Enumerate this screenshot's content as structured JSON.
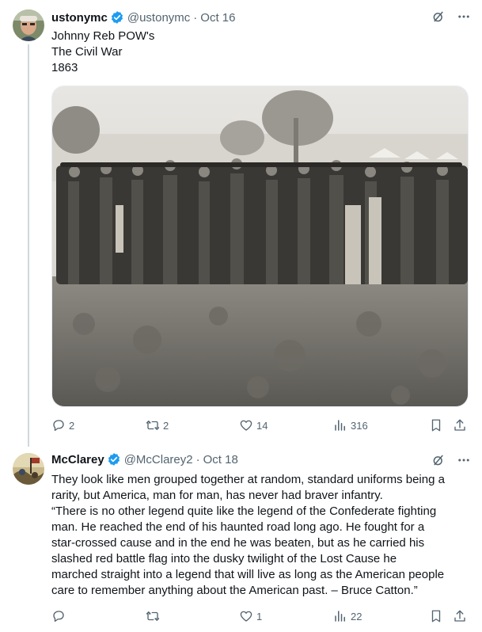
{
  "tweets": [
    {
      "author": {
        "name": "ustonymc",
        "handle": "@ustonymc",
        "avatar_icon": "profile-photo-man"
      },
      "date": "Oct 16",
      "text_lines": [
        "Johnny Reb POW's",
        "The Civil War",
        "1863"
      ],
      "media": {
        "type": "photo",
        "description_icon": "civil-war-prisoners-photo"
      },
      "stats": {
        "replies": "2",
        "reposts": "2",
        "likes": "14",
        "views": "316"
      }
    },
    {
      "author": {
        "name": "McClarey",
        "handle": "@McClarey2",
        "avatar_icon": "profile-painting-battle"
      },
      "date": "Oct 18",
      "text_lines": [
        "They look like men grouped together at random, standard uniforms being a",
        "rarity, but America, man for man, has never had braver infantry.",
        "“There is no  other legend quite like the legend of the Confederate fighting",
        "man. He  reached the end of his haunted road long ago. He fought for a",
        "star-crossed cause and in the end he was beaten, but as he carried his",
        "slashed red battle flag into the dusky twilight of the Lost Cause he",
        "marched straight into a legend that will live as long as the American  people",
        "care to remember anything about the American past. – Bruce  Catton.”"
      ],
      "stats": {
        "replies": "",
        "reposts": "",
        "likes": "1",
        "views": "22"
      }
    }
  ],
  "ui": {
    "dot_separator": "·",
    "colors": {
      "verified": "#1d9bf0",
      "secondary_text": "#536471",
      "thread_line": "#cfd9de"
    },
    "icons": [
      "verified-badge-icon",
      "grok-icon",
      "more-icon",
      "reply-icon",
      "repost-icon",
      "like-icon",
      "views-icon",
      "bookmark-icon",
      "share-icon"
    ]
  }
}
